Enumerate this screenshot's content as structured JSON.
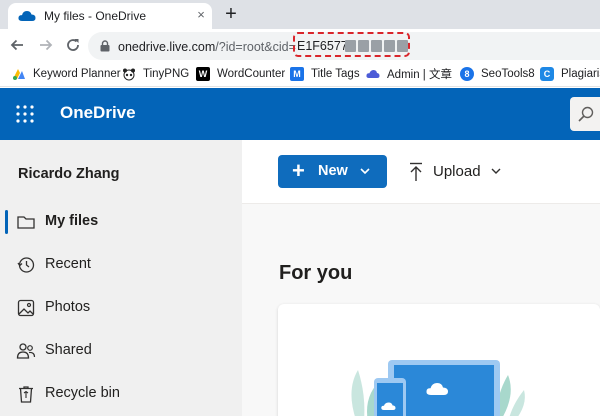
{
  "browser": {
    "tab": {
      "title": "My files - OneDrive",
      "close": "×"
    },
    "new_tab": "+",
    "address": {
      "host": "onedrive.live.com",
      "path": "/?id=root&cid=",
      "cid_visible": "E1F6577"
    },
    "bookmarks": [
      {
        "label": "Keyword Planner",
        "icon": "keyword-planner-icon",
        "color": "#4285f4"
      },
      {
        "label": "TinyPNG",
        "icon": "tinypng-panda-icon",
        "color": "#000000"
      },
      {
        "label": "WordCounter",
        "icon": "wordcounter-w-icon",
        "color": "#000000",
        "glyph": "W"
      },
      {
        "label": "Title Tags",
        "icon": "title-tags-m-icon",
        "color": "#1a73e8",
        "glyph": "M"
      },
      {
        "label": "Admin | 文章",
        "icon": "cloud-icon",
        "color": "#4b5bd7"
      },
      {
        "label": "SeoTools8",
        "icon": "seotools-icon",
        "color": "#1a73e8",
        "glyph": "8"
      },
      {
        "label": "Plagiaris",
        "icon": "plagiarism-icon",
        "color": "#1e88e5",
        "glyph": "C"
      }
    ]
  },
  "app": {
    "brand": "OneDrive",
    "brand_color": "#0364b8"
  },
  "nav": {
    "user_name": "Ricardo Zhang",
    "items": [
      {
        "label": "My files",
        "icon": "folder-icon",
        "active": true
      },
      {
        "label": "Recent",
        "icon": "recent-clock-icon",
        "active": false
      },
      {
        "label": "Photos",
        "icon": "photos-icon",
        "active": false
      },
      {
        "label": "Shared",
        "icon": "shared-people-icon",
        "active": false
      },
      {
        "label": "Recycle bin",
        "icon": "recycle-bin-icon",
        "active": false
      }
    ]
  },
  "commands": {
    "new_label": "New",
    "upload_label": "Upload"
  },
  "main": {
    "section_title": "For you"
  }
}
